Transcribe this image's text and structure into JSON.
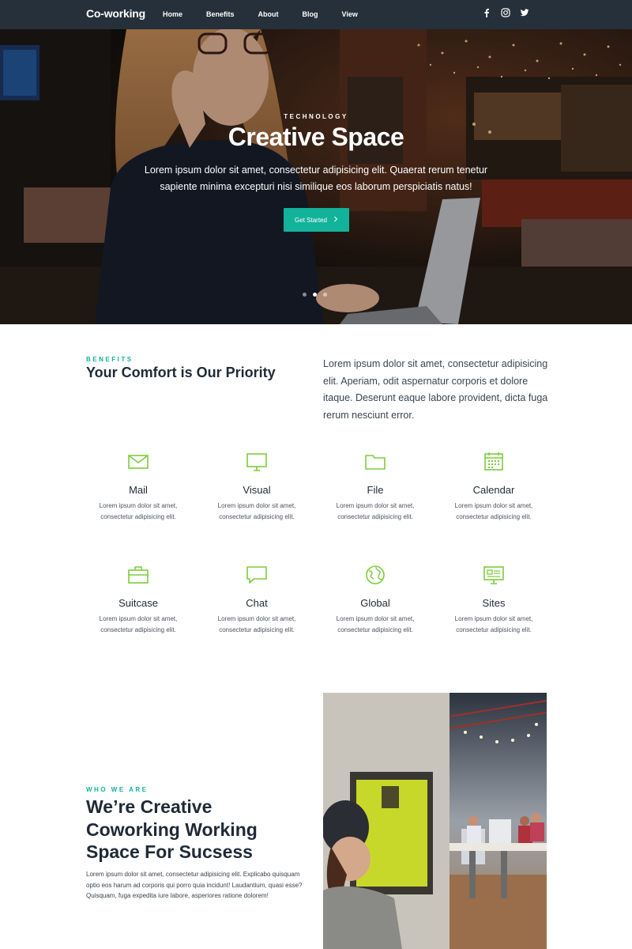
{
  "nav": {
    "brand": "Co-working",
    "items": [
      {
        "label": "Home"
      },
      {
        "label": "Benefits"
      },
      {
        "label": "About"
      },
      {
        "label": "Blog"
      },
      {
        "label": "View"
      }
    ],
    "social": [
      "facebook-icon",
      "instagram-icon",
      "twitter-icon"
    ]
  },
  "hero": {
    "eyebrow": "TECHNOLOGY",
    "title": "Creative Space",
    "text": "Lorem ipsum dolor sit amet, consectetur adipisicing elit. Quaerat rerum tenetur sapiente minima excepturi nisi similique eos laborum perspiciatis natus!",
    "button_label": "Get Started",
    "slide_count": 3,
    "active_slide": 2
  },
  "benefits": {
    "eyebrow": "BENEFITS",
    "title": "Your Comfort is Our Priority",
    "text": "Lorem ipsum dolor sit amet, consectetur adipisicing elit. Aperiam, odit aspernatur corporis et dolore itaque. Deserunt eaque labore provident, dicta fuga rerum nesciunt error.",
    "features": [
      {
        "title": "Mail",
        "icon": "mail-icon",
        "text": "Lorem ipsum dolor sit amet, consectetur adipisicing elit."
      },
      {
        "title": "Visual",
        "icon": "monitor-icon",
        "text": "Lorem ipsum dolor sit amet, consectetur adipisicing elit."
      },
      {
        "title": "File",
        "icon": "folder-icon",
        "text": "Lorem ipsum dolor sit amet, consectetur adipisicing elit."
      },
      {
        "title": "Calendar",
        "icon": "calendar-icon",
        "text": "Lorem ipsum dolor sit amet, consectetur adipisicing elit."
      },
      {
        "title": "Suitcase",
        "icon": "suitcase-icon",
        "text": "Lorem ipsum dolor sit amet, consectetur adipisicing elit."
      },
      {
        "title": "Chat",
        "icon": "chat-icon",
        "text": "Lorem ipsum dolor sit amet, consectetur adipisicing elit."
      },
      {
        "title": "Global",
        "icon": "globe-icon",
        "text": "Lorem ipsum dolor sit amet, consectetur adipisicing elit."
      },
      {
        "title": "Sites",
        "icon": "sites-icon",
        "text": "Lorem ipsum dolor sit amet, consectetur adipisicing elit."
      }
    ]
  },
  "about": {
    "eyebrow": "WHO WE ARE",
    "title": "We’re Creative Coworking Working Space For Sucsess",
    "text": "Lorem ipsum dolor sit amet, consectetur adipisicing elit. Explicabo quisquam optio eos harum ad corporis qui porro quia incidunt! Laudantium, quasi esse? Quisquam, fuga expedita iure labore, asperiores ratione dolorem!"
  },
  "colors": {
    "nav_bg": "#25303a",
    "accent": "#13b29b",
    "icon_green": "#7ccd3c",
    "heading": "#1f2a36"
  }
}
